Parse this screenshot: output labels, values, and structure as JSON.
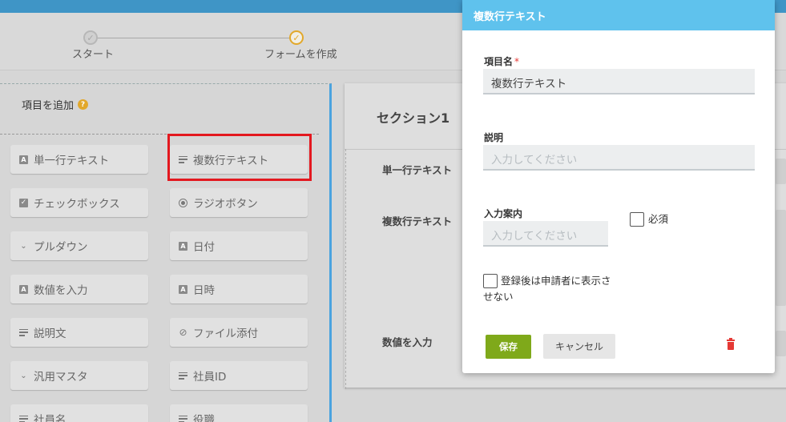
{
  "stepper": {
    "steps": [
      {
        "label": "スタート"
      },
      {
        "label": "フォームを作成"
      }
    ]
  },
  "palette": {
    "title": "項目を追加",
    "items": [
      {
        "label": "単一行テキスト",
        "icon": "text-a-icon"
      },
      {
        "label": "複数行テキスト",
        "icon": "multiline-icon"
      },
      {
        "label": "チェックボックス",
        "icon": "checkbox-icon"
      },
      {
        "label": "ラジオボタン",
        "icon": "radio-icon"
      },
      {
        "label": "プルダウン",
        "icon": "chevron-down-icon"
      },
      {
        "label": "日付",
        "icon": "text-a-icon"
      },
      {
        "label": "数値を入力",
        "icon": "text-a-icon"
      },
      {
        "label": "日時",
        "icon": "text-a-icon"
      },
      {
        "label": "説明文",
        "icon": "multiline-icon"
      },
      {
        "label": "ファイル添付",
        "icon": "paperclip-icon"
      },
      {
        "label": "汎用マスタ",
        "icon": "chevron-down-icon"
      },
      {
        "label": "社員ID",
        "icon": "multiline-icon"
      },
      {
        "label": "社員名",
        "icon": "multiline-icon"
      },
      {
        "label": "役職",
        "icon": "multiline-icon"
      }
    ]
  },
  "form": {
    "section_title": "セクション1",
    "fields": [
      "単一行テキスト",
      "複数行テキスト",
      "数値を入力"
    ]
  },
  "modal": {
    "title": "複数行テキスト",
    "name_label": "項目名",
    "required_mark": "*",
    "name_value": "複数行テキスト",
    "desc_label": "説明",
    "desc_placeholder": "入力してください",
    "guide_label": "入力案内",
    "guide_placeholder": "入力してください",
    "required_label": "必須",
    "hide_label_line1": "登録後は申請者に表示さ",
    "hide_label_line2": "せない",
    "save_label": "保存",
    "cancel_label": "キャンセル"
  },
  "colors": {
    "header_bar": "#3f95c6",
    "modal_header": "#5fc2ed",
    "save_button": "#7fa91a",
    "delete_icon": "#e53935",
    "step_active": "#e2a82b",
    "highlight": "#e3181f"
  }
}
